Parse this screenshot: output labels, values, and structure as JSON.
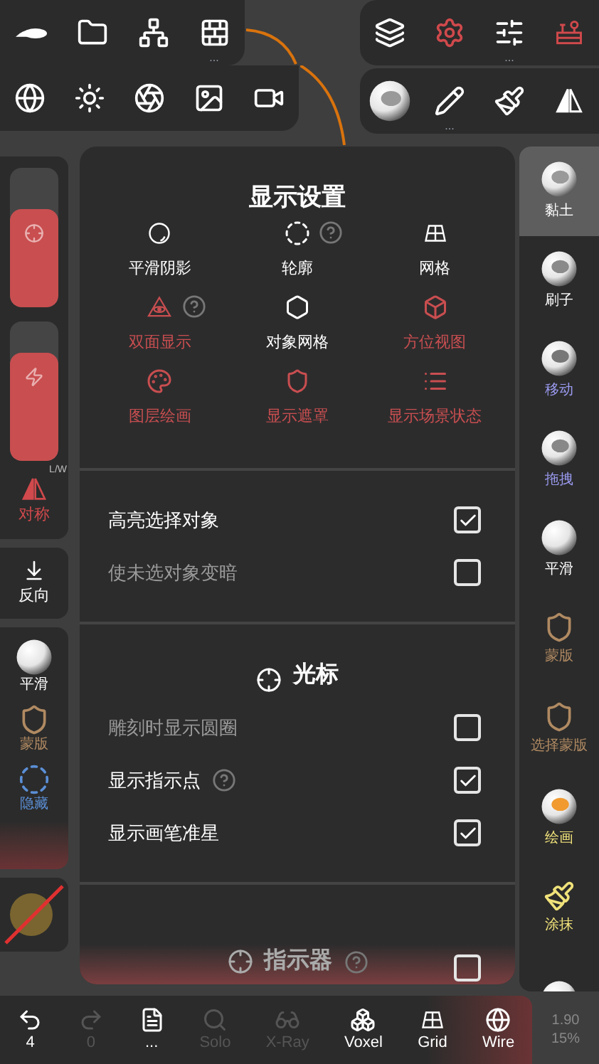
{
  "toolbar_left": [
    [
      {
        "active": false
      },
      {
        "active": false
      },
      {
        "active": false
      },
      {
        "active": false,
        "more": "..."
      }
    ],
    [
      {
        "active": false
      },
      {
        "active": false
      },
      {
        "active": false
      },
      {
        "active": false
      },
      {
        "active": false
      }
    ]
  ],
  "toolbar_right": [
    [
      {
        "active": false
      },
      {
        "active": true
      },
      {
        "active": false,
        "more": "..."
      },
      {
        "active": true
      }
    ],
    [
      {
        "active": false
      },
      {
        "active": false,
        "more": "..."
      },
      {
        "active": false
      },
      {
        "active": false
      }
    ]
  ],
  "left_panel": {
    "sliders": [
      {
        "level": 0.7
      },
      {
        "level": 0.78
      }
    ],
    "symmetry": {
      "label": "对称",
      "badge": "L/W",
      "on": true
    },
    "invert": {
      "label": "反向"
    },
    "tools": [
      {
        "label": "平滑",
        "color": "#ffffff"
      },
      {
        "label": "蒙版",
        "color": "#b08a62"
      },
      {
        "label": "隐藏",
        "color": "#5b8fd6"
      }
    ]
  },
  "display_settings": {
    "title": "显示设置",
    "toggles": [
      {
        "label": "平滑阴影",
        "on": true,
        "help": false
      },
      {
        "label": "轮廓",
        "on": true,
        "help": true
      },
      {
        "label": "网格",
        "on": true,
        "help": false
      },
      {
        "label": "双面显示",
        "on": false,
        "help": true
      },
      {
        "label": "对象网格",
        "on": true,
        "help": false
      },
      {
        "label": "方位视图",
        "on": false,
        "help": false
      },
      {
        "label": "图层绘画",
        "on": false,
        "help": false
      },
      {
        "label": "显示遮罩",
        "on": false,
        "help": false
      },
      {
        "label": "显示场景状态",
        "on": false,
        "help": false
      }
    ],
    "object_options": [
      {
        "label": "高亮选择对象",
        "checked": true,
        "help": false
      },
      {
        "label": "使未选对象变暗",
        "checked": false,
        "help": false
      }
    ]
  },
  "cursor": {
    "title": "光标",
    "options": [
      {
        "label": "雕刻时显示圆圈",
        "checked": false,
        "help": false
      },
      {
        "label": "显示指示点",
        "checked": true,
        "help": true
      },
      {
        "label": "显示画笔准星",
        "checked": true,
        "help": false
      }
    ]
  },
  "gizmo": {
    "title": "指示器",
    "help": true,
    "checked": false
  },
  "tools": [
    {
      "label": "黏土",
      "selected": true,
      "color": "#ffffff"
    },
    {
      "label": "刷子",
      "selected": false,
      "color": "#ffffff"
    },
    {
      "label": "移动",
      "selected": false,
      "color": "#9a9af0"
    },
    {
      "label": "拖拽",
      "selected": false,
      "color": "#9a9af0"
    },
    {
      "label": "平滑",
      "selected": false,
      "color": "#ffffff"
    },
    {
      "label": "蒙版",
      "selected": false,
      "color": "#b08a62"
    },
    {
      "label": "选择蒙版",
      "selected": false,
      "color": "#b08a62"
    },
    {
      "label": "绘画",
      "selected": false,
      "color": "#f0e27a"
    },
    {
      "label": "涂抹",
      "selected": false,
      "color": "#f0e27a"
    },
    {
      "selected": false
    }
  ],
  "bottom_bar": [
    {
      "label": "4",
      "disabled": false
    },
    {
      "label": "0",
      "disabled": true
    },
    {
      "label": "...",
      "disabled": false
    },
    {
      "label": "Solo",
      "disabled": true
    },
    {
      "label": "X-Ray",
      "disabled": true
    },
    {
      "label": "Voxel",
      "disabled": false
    },
    {
      "label": "Grid",
      "disabled": false
    },
    {
      "label": "Wire",
      "disabled": false
    }
  ],
  "stats": [
    "1.90",
    "15%"
  ]
}
